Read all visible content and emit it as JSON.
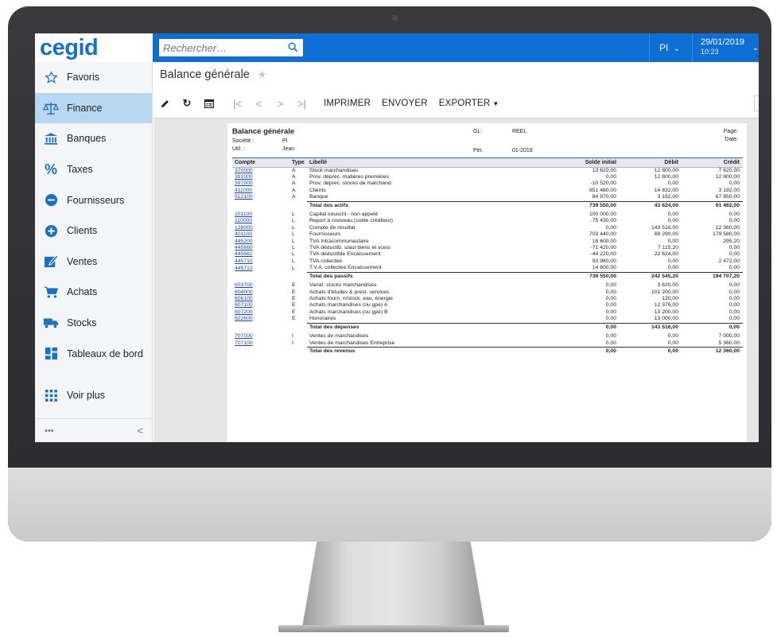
{
  "topbar": {
    "logo": "cegid",
    "search_placeholder": "Rechercher…",
    "company": "PI",
    "date": "29/01/2019",
    "time": "10:23"
  },
  "sidebar": {
    "items": [
      {
        "label": "Favoris",
        "icon": "star-outline-icon"
      },
      {
        "label": "Finance",
        "icon": "scales-icon",
        "active": true
      },
      {
        "label": "Banques",
        "icon": "bank-icon"
      },
      {
        "label": "Taxes",
        "icon": "percent-icon"
      },
      {
        "label": "Fournisseurs",
        "icon": "minus-circle-icon"
      },
      {
        "label": "Clients",
        "icon": "plus-circle-icon"
      },
      {
        "label": "Ventes",
        "icon": "edit-icon"
      },
      {
        "label": "Achats",
        "icon": "cart-icon"
      },
      {
        "label": "Stocks",
        "icon": "truck-icon"
      },
      {
        "label": "Tableaux de bord",
        "icon": "dashboard-icon"
      }
    ],
    "more_label": "Voir plus",
    "dots": "•••",
    "collapse": "<"
  },
  "page": {
    "title": "Balance générale"
  },
  "toolbar": {
    "print": "IMPRIMER",
    "send": "ENVOYER",
    "export": "EXPORTER"
  },
  "report": {
    "title": "Balance générale",
    "company_label": "Société :",
    "company_value": "PI",
    "user_label": "Util. :",
    "user_value": "Jean",
    "gl_label": "GL:",
    "gl_value": "REEL",
    "period_label": "Pér.",
    "period_value": "01-2019",
    "page_label": "Page:",
    "date_label": "Date:",
    "columns": {
      "account": "Compte",
      "type": "Type",
      "label": "Libellé",
      "opening": "Solde initial",
      "debit": "Débit",
      "credit": "Crédit"
    },
    "sections": [
      {
        "rows": [
          [
            "370000",
            "A",
            "Stock marchandises",
            "13 620,00",
            "12 800,00",
            "7 620,00"
          ],
          [
            "391000",
            "A",
            "Prov. déprec. matières premières",
            "0,00",
            "12 800,00",
            "12 800,00"
          ],
          [
            "397000",
            "A",
            "Prov. déprec. stocks de marchand.",
            "-10 520,00",
            "0,00",
            "0,00"
          ],
          [
            "411000",
            "A",
            "Clients",
            "651 480,00",
            "14 832,00",
            "3 192,00"
          ],
          [
            "512100",
            "A",
            "Banque",
            "84 970,00",
            "3 192,00",
            "67 850,00"
          ]
        ],
        "total": [
          "Total des actifs",
          "739 550,00",
          "43 624,00",
          "91 462,00"
        ]
      },
      {
        "rows": [
          [
            "101100",
            "L",
            "Capital souscrit - non appelé",
            "100 000,00",
            "0,00",
            "0,00"
          ],
          [
            "110000",
            "L",
            "Report à nouveau (solde créditeur)",
            "-75 430,00",
            "0,00",
            "0,00"
          ],
          [
            "128000",
            "L",
            "Compte de résultat",
            "0,00",
            "143 516,00",
            "12 360,00"
          ],
          [
            "401100",
            "L",
            "Fournisseurs",
            "703 440,00",
            "69 290,00",
            "179 580,00"
          ],
          [
            "445200",
            "L",
            "TVA Intracommunautaire",
            "18 600,00",
            "0,00",
            "295,20"
          ],
          [
            "445660",
            "L",
            "TVA déductib. s/aut biens et sces/",
            "-71 420,00",
            "7 115,20",
            "0,00"
          ],
          [
            "445662",
            "L",
            "TVA déductible Encaissement",
            "-44 220,00",
            "22 624,00",
            "0,00"
          ],
          [
            "445710",
            "L",
            "TVA collectée",
            "93 980,00",
            "0,00",
            "2 472,00"
          ],
          [
            "445712",
            "L",
            "T.V.A. collectée Encaissement",
            "14 600,00",
            "0,00",
            "0,00"
          ]
        ],
        "total": [
          "Total des passifs",
          "739 550,00",
          "242 545,20",
          "194 707,20"
        ]
      },
      {
        "rows": [
          [
            "603700",
            "E",
            "Variat. stocks marchandises",
            "0,00",
            "3 620,00",
            "0,00"
          ],
          [
            "604000",
            "E",
            "Achats d'études & prest. services",
            "0,00",
            "101 200,00",
            "0,00"
          ],
          [
            "606100",
            "E",
            "Achats fourn. n/stock. eau, énergie",
            "0,00",
            "120,00",
            "0,00"
          ],
          [
            "607100",
            "E",
            "Achats marchandises (ou gpe) A",
            "0,00",
            "12 376,00",
            "0,00"
          ],
          [
            "607200",
            "E",
            "Achats marchandises (ou gpe) B",
            "0,00",
            "13 200,00",
            "0,00"
          ],
          [
            "622600",
            "E",
            "Honoraires",
            "0,00",
            "13 000,00",
            "0,00"
          ]
        ],
        "total": [
          "Total des dépenses",
          "0,00",
          "143 516,00",
          "0,00"
        ]
      },
      {
        "rows": [
          [
            "707000",
            "I",
            "Ventes de marchandises",
            "0,00",
            "0,00",
            "7 000,00"
          ],
          [
            "707100",
            "I",
            "Ventes de marchandises Entreprise",
            "0,00",
            "0,00",
            "5 360,00"
          ]
        ],
        "total": [
          "Total des revenus",
          "0,00",
          "0,00",
          "12 360,00"
        ]
      }
    ]
  },
  "colors": {
    "brand_blue": "#0d6fd4",
    "logo_blue": "#1272c9",
    "active_nav": "#b8d8f2",
    "link": "#1a45b8"
  }
}
